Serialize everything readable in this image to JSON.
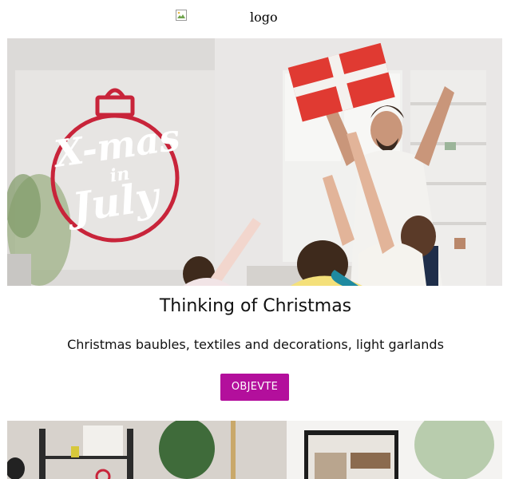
{
  "header": {
    "logo_alt": "logo"
  },
  "hero": {
    "overlay_icon": "xmas-in-july-ornament-icon",
    "accent_color": "#c8243a"
  },
  "promo": {
    "headline": "Thinking of Christmas",
    "description": "Christmas baubles, textiles and decorations, light garlands",
    "button_label": "OBJEVTE",
    "button_color": "#b30f9c"
  }
}
